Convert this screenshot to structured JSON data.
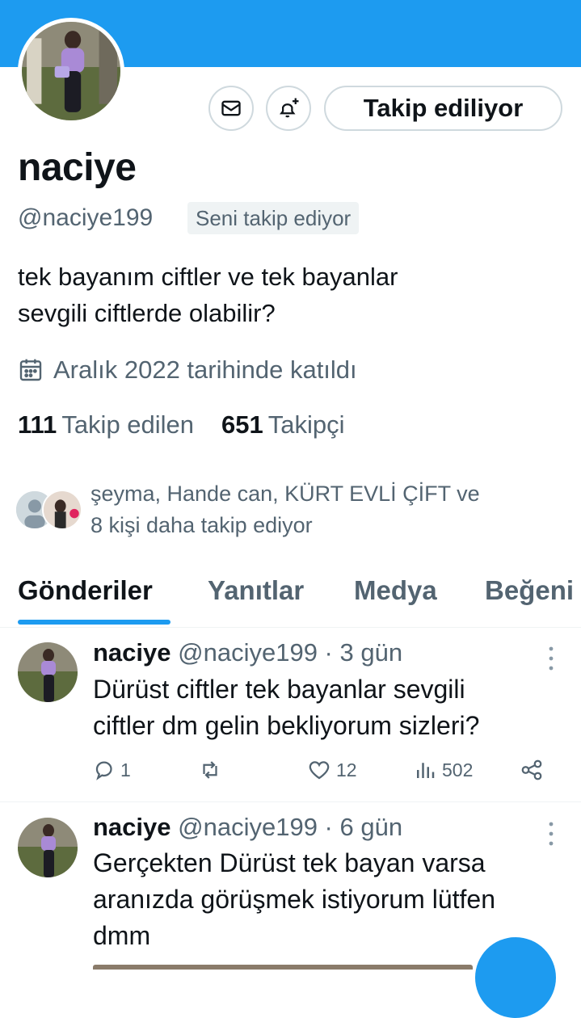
{
  "profile": {
    "display_name": "naciye",
    "handle": "@naciye199",
    "follows_you": "Seni takip ediyor",
    "bio_line1": "tek bayanım ciftler ve tek bayanlar",
    "bio_line2": "sevgili ciftlerde olabilir?",
    "joined": "Aralık 2022 tarihinde katıldı",
    "following_count": "111",
    "following_label": "Takip edilen",
    "followers_count": "651",
    "followers_label": "Takipçi",
    "follow_button": "Takip ediliyor",
    "known_followers_line1": "şeyma, Hande can, KÜRT EVLİ ÇİFT ve",
    "known_followers_line2": "8 kişi daha takip ediyor"
  },
  "icons": {
    "message": "envelope-icon",
    "notify": "bell-plus-icon",
    "calendar": "calendar-icon",
    "reply": "speech-bubble-icon",
    "retweet": "retweet-icon",
    "like": "heart-icon",
    "views": "bar-chart-icon",
    "share": "share-icon",
    "more": "vertical-ellipsis-icon"
  },
  "tabs": [
    {
      "label": "Gönderiler"
    },
    {
      "label": "Yanıtlar"
    },
    {
      "label": "Medya"
    },
    {
      "label": "Beğeni"
    }
  ],
  "tweets": [
    {
      "name": "naciye",
      "meta": "@naciye199 · 3 gün",
      "text_line1": "Dürüst ciftler tek bayanlar sevgili",
      "text_line2": "ciftler dm gelin bekliyorum sizleri?",
      "replies": "1",
      "likes": "12",
      "views": "502"
    },
    {
      "name": "naciye",
      "meta": "@naciye199 · 6 gün",
      "text_line1": "Gerçekten Dürüst tek bayan varsa",
      "text_line2": "aranızda görüşmek istiyorum lütfen",
      "text_line3": "dmm"
    }
  ],
  "colors": {
    "accent": "#1d9bf0",
    "text_primary": "#0f1419",
    "text_secondary": "#536471",
    "border": "#cfd9de"
  }
}
